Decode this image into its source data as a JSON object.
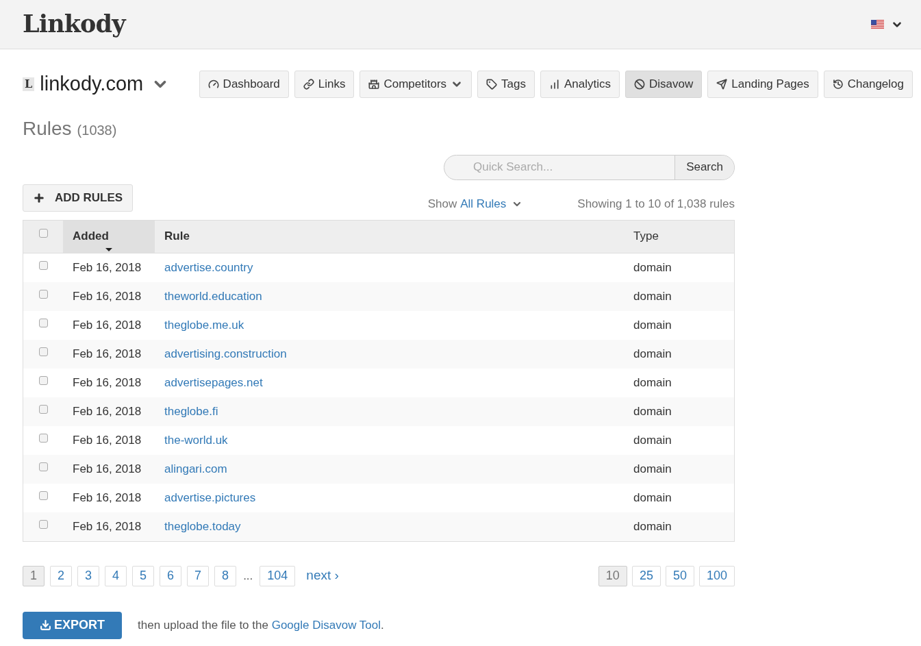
{
  "header": {
    "logo": "Linkody"
  },
  "site": {
    "letter": "L",
    "name": "linkody.com"
  },
  "nav": [
    {
      "label": "Dashboard",
      "selected": false,
      "dropdown": false
    },
    {
      "label": "Links",
      "selected": false,
      "dropdown": false
    },
    {
      "label": "Competitors",
      "selected": false,
      "dropdown": true
    },
    {
      "label": "Tags",
      "selected": false,
      "dropdown": false
    },
    {
      "label": "Analytics",
      "selected": false,
      "dropdown": false
    },
    {
      "label": "Disavow",
      "selected": true,
      "dropdown": false
    },
    {
      "label": "Landing Pages",
      "selected": false,
      "dropdown": false
    },
    {
      "label": "Changelog",
      "selected": false,
      "dropdown": false
    }
  ],
  "page_title": {
    "title": "Rules",
    "count": "(1038)"
  },
  "search": {
    "placeholder": "Quick Search...",
    "button": "Search"
  },
  "add_button": "ADD RULES",
  "filter": {
    "prefix": "Show",
    "value": "All Rules"
  },
  "summary": "Showing 1 to 10 of 1,038 rules",
  "table": {
    "select_all_checked": false,
    "columns": [
      {
        "label": "Added",
        "sorted": true
      },
      {
        "label": "Rule",
        "sorted": false
      },
      {
        "label": "Type",
        "sorted": false
      }
    ],
    "rows": [
      {
        "checked": false,
        "added": "Feb 16, 2018",
        "rule": "advertise.country",
        "type": "domain"
      },
      {
        "checked": false,
        "added": "Feb 16, 2018",
        "rule": "theworld.education",
        "type": "domain"
      },
      {
        "checked": false,
        "added": "Feb 16, 2018",
        "rule": "theglobe.me.uk",
        "type": "domain"
      },
      {
        "checked": false,
        "added": "Feb 16, 2018",
        "rule": "advertising.construction",
        "type": "domain"
      },
      {
        "checked": false,
        "added": "Feb 16, 2018",
        "rule": "advertisepages.net",
        "type": "domain"
      },
      {
        "checked": false,
        "added": "Feb 16, 2018",
        "rule": "theglobe.fi",
        "type": "domain"
      },
      {
        "checked": false,
        "added": "Feb 16, 2018",
        "rule": "the-world.uk",
        "type": "domain"
      },
      {
        "checked": false,
        "added": "Feb 16, 2018",
        "rule": "alingari.com",
        "type": "domain"
      },
      {
        "checked": false,
        "added": "Feb 16, 2018",
        "rule": "advertise.pictures",
        "type": "domain"
      },
      {
        "checked": false,
        "added": "Feb 16, 2018",
        "rule": "theglobe.today",
        "type": "domain"
      }
    ]
  },
  "pagination": {
    "pages": [
      {
        "label": "1",
        "selected": true
      },
      {
        "label": "2",
        "selected": false
      },
      {
        "label": "3",
        "selected": false
      },
      {
        "label": "4",
        "selected": false
      },
      {
        "label": "5",
        "selected": false
      },
      {
        "label": "6",
        "selected": false
      },
      {
        "label": "7",
        "selected": false
      },
      {
        "label": "8",
        "selected": false
      }
    ],
    "ellipsis": "...",
    "last": {
      "label": "104",
      "selected": false
    },
    "next": "next ›"
  },
  "per_page": [
    {
      "label": "10",
      "selected": true
    },
    {
      "label": "25",
      "selected": false
    },
    {
      "label": "50",
      "selected": false
    },
    {
      "label": "100",
      "selected": false
    }
  ],
  "export": {
    "button": "EXPORT",
    "before": "then upload the file to the ",
    "link": "Google Disavow Tool",
    "after": "."
  }
}
